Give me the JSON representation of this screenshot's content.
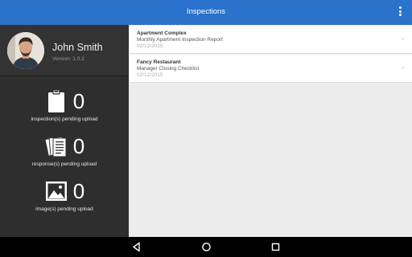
{
  "appbar": {
    "title": "Inspections",
    "menu_icon": "overflow-menu-icon"
  },
  "profile": {
    "name": "John Smith",
    "version": "Version: 1.0.2"
  },
  "stats": [
    {
      "icon": "clipboard-icon",
      "count": "0",
      "label": "inspection(s) pending upload"
    },
    {
      "icon": "documents-icon",
      "count": "0",
      "label": "response(s) pending upload"
    },
    {
      "icon": "image-icon",
      "count": "0",
      "label": "image(s) pending upload"
    }
  ],
  "inspections": [
    {
      "title": "Apartment Complex",
      "subtitle": "Monthly Apartment Inspection Report",
      "date": "02/12/2015"
    },
    {
      "title": "Fancy Restaurant",
      "subtitle": "Manager Closing Checklist",
      "date": "02/12/2015"
    }
  ],
  "nav": {
    "back_icon": "back-icon",
    "home_icon": "home-icon",
    "recents_icon": "recents-icon"
  },
  "colors": {
    "appbar": "#2a72cc",
    "sidebar": "#2e2e2e",
    "content": "#ececec"
  }
}
